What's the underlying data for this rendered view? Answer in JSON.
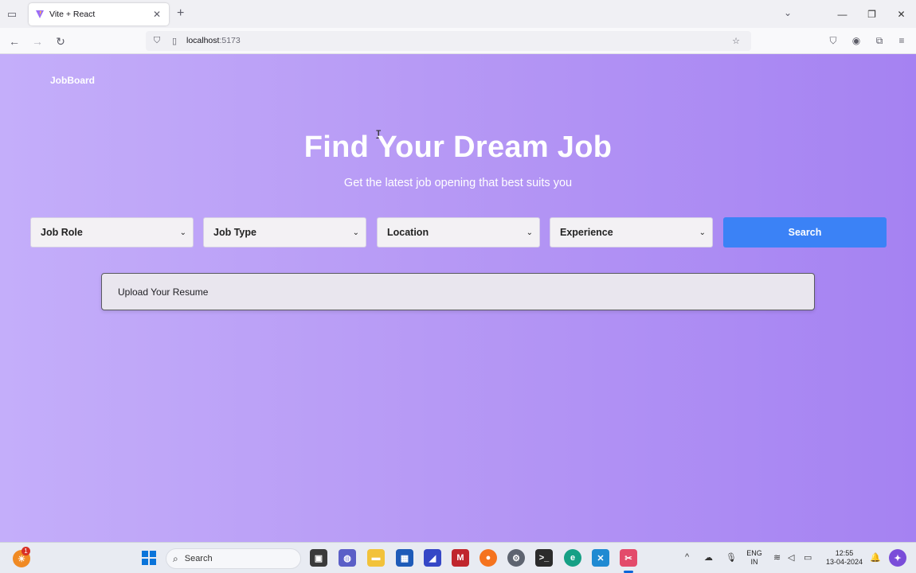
{
  "browser": {
    "tab_title": "Vite + React",
    "url_host": "localhost",
    "url_port": ":5173"
  },
  "page": {
    "brand": "JobBoard",
    "hero_title": "Find Your Dream Job",
    "hero_subtitle": "Get the latest job opening that best suits you",
    "filters": [
      {
        "label": "Job Role"
      },
      {
        "label": "Job Type"
      },
      {
        "label": "Location"
      },
      {
        "label": "Experience"
      }
    ],
    "search_label": "Search",
    "upload_label": "Upload Your Resume"
  },
  "taskbar": {
    "search_placeholder": "Search",
    "notification_count": "1",
    "lang_line1": "ENG",
    "lang_line2": "IN",
    "time": "12:55",
    "date": "13-04-2024"
  },
  "colors": {
    "accent": "#3b82f6",
    "gradient_start": "#c4aefa",
    "gradient_end": "#a582f2"
  }
}
